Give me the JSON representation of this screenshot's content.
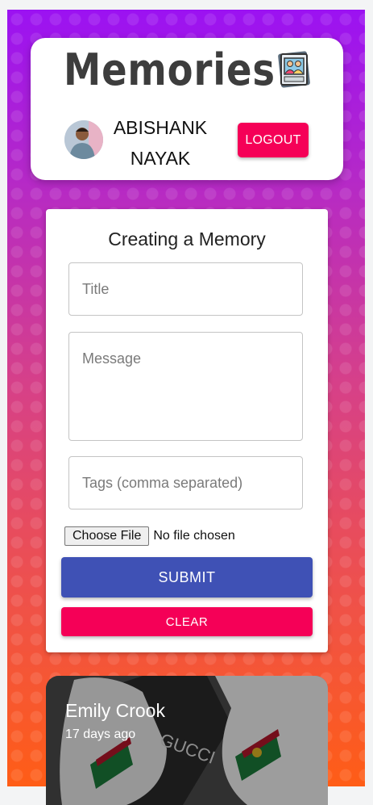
{
  "app": {
    "brand": "Memories",
    "logo_icon": "photo-album-icon"
  },
  "header": {
    "user_name": "ABISHANK NAYAK",
    "logout_label": "LOGOUT"
  },
  "form": {
    "title": "Creating a Memory",
    "title_placeholder": "Title",
    "message_placeholder": "Message",
    "tags_placeholder": "Tags (comma separated)",
    "choose_file_label": "Choose File",
    "no_file_text": "No file chosen",
    "submit_label": "SUBMIT",
    "clear_label": "CLEAR"
  },
  "posts": [
    {
      "author": "Emily Crook",
      "time": "17 days ago"
    }
  ],
  "colors": {
    "primary": "#3f51b5",
    "secondary": "#f50057",
    "gradient_top": "#9b12f2",
    "gradient_bottom": "#ff5d16"
  }
}
